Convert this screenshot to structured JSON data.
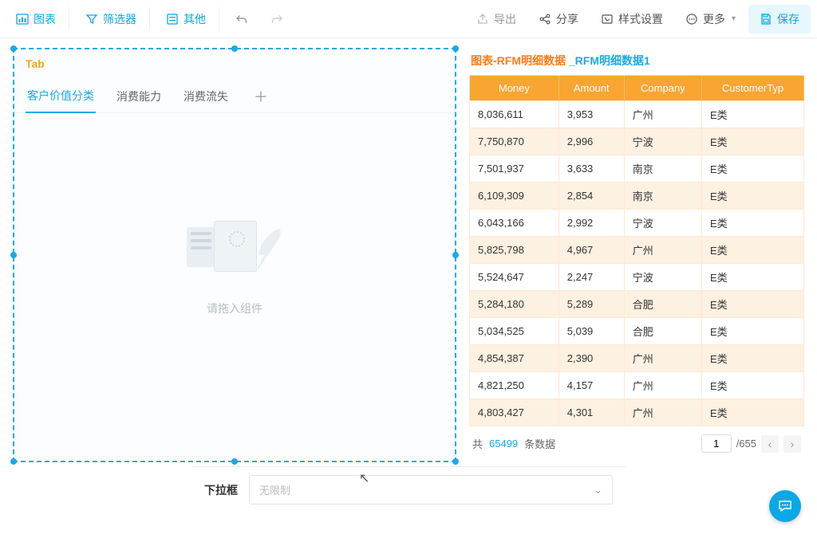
{
  "toolbar": {
    "chart": "图表",
    "filter": "筛选器",
    "other": "其他",
    "export": "导出",
    "share": "分享",
    "style": "样式设置",
    "more": "更多",
    "save": "保存"
  },
  "tabPanel": {
    "label": "Tab",
    "tabs": [
      "客户价值分类",
      "消费能力",
      "消费流失"
    ],
    "activeIndex": 0,
    "emptyText": "请拖入组件"
  },
  "dataPanel": {
    "title_prefix": "图表-RFM明细数据 ",
    "title_suffix": "_RFM明细数据1",
    "columns": [
      "Money",
      "Amount",
      "Company",
      "CustomerTyp"
    ],
    "rows": [
      [
        "8,036,611",
        "3,953",
        "广州",
        "E类"
      ],
      [
        "7,750,870",
        "2,996",
        "宁波",
        "E类"
      ],
      [
        "7,501,937",
        "3,633",
        "南京",
        "E类"
      ],
      [
        "6,109,309",
        "2,854",
        "南京",
        "E类"
      ],
      [
        "6,043,166",
        "2,992",
        "宁波",
        "E类"
      ],
      [
        "5,825,798",
        "4,967",
        "广州",
        "E类"
      ],
      [
        "5,524,647",
        "2,247",
        "宁波",
        "E类"
      ],
      [
        "5,284,180",
        "5,289",
        "合肥",
        "E类"
      ],
      [
        "5,034,525",
        "5,039",
        "合肥",
        "E类"
      ],
      [
        "4,854,387",
        "2,390",
        "广州",
        "E类"
      ],
      [
        "4,821,250",
        "4,157",
        "广州",
        "E类"
      ],
      [
        "4,803,427",
        "4,301",
        "广州",
        "E类"
      ]
    ],
    "pager": {
      "totalPrefix": "共",
      "total": "65499",
      "totalSuffix": "条数据",
      "currentPage": "1",
      "totalPages": "/655"
    }
  },
  "bottom": {
    "label": "下拉框",
    "placeholder": "无限制"
  }
}
